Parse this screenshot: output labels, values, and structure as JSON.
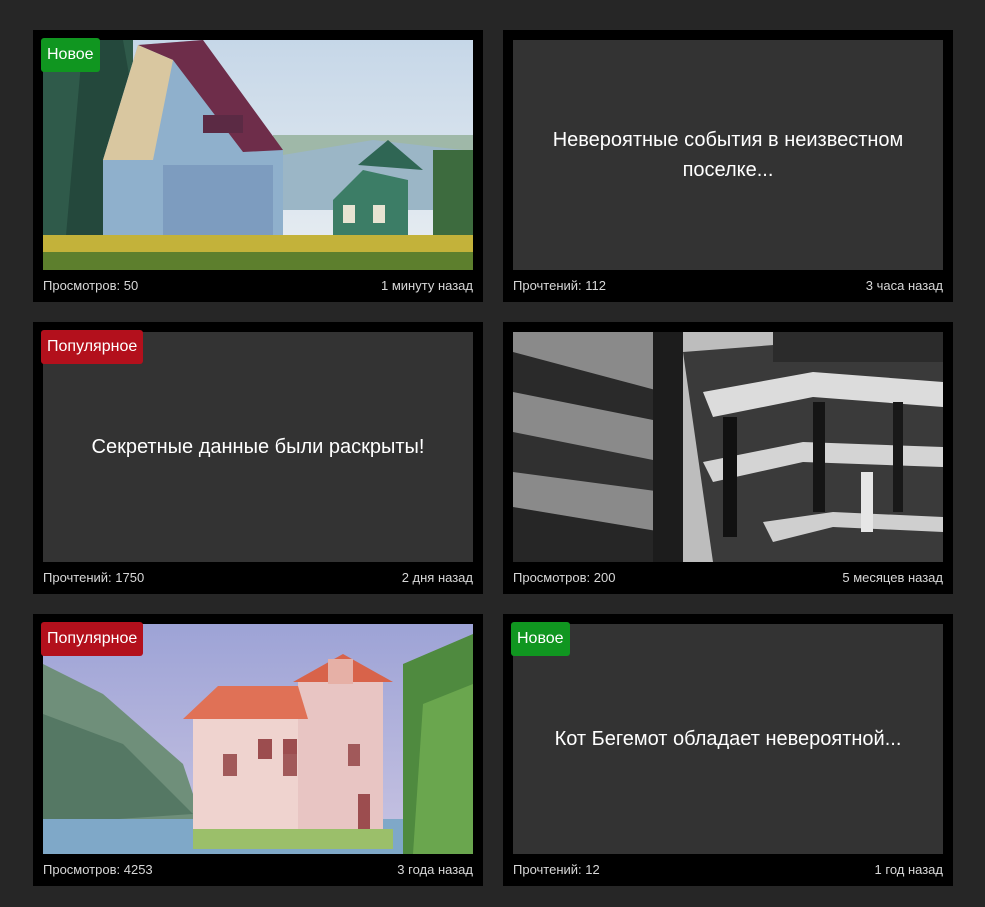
{
  "cards": [
    {
      "badge": "Новое",
      "badge_type": "new",
      "image": "painting-house-village",
      "title": "",
      "count_label": "Просмотров: 50",
      "time": "1 минуту назад"
    },
    {
      "badge": "",
      "badge_type": "",
      "image": "",
      "title": "Невероятные события в неизвестном поселке...",
      "count_label": "Прочтений: 112",
      "time": "3 часа назад"
    },
    {
      "badge": "Популярное",
      "badge_type": "popular",
      "image": "",
      "title": "Секретные данные были раскрыты!",
      "count_label": "Прочтений: 1750",
      "time": "2 дня назад"
    },
    {
      "badge": "",
      "badge_type": "",
      "image": "ink-building-construction",
      "title": "",
      "count_label": "Просмотров: 200",
      "time": "5 месяцев назад"
    },
    {
      "badge": "Популярное",
      "badge_type": "popular",
      "image": "painting-white-house-lake",
      "title": "",
      "count_label": "Просмотров: 4253",
      "time": "3 года назад"
    },
    {
      "badge": "Новое",
      "badge_type": "new",
      "image": "",
      "title": "Кот Бегемот обладает невероятной...",
      "count_label": "Прочтений: 12",
      "time": "1 год назад"
    }
  ],
  "colors": {
    "page_bg": "#262626",
    "card_bg": "#000000",
    "placeholder_bg": "#333333",
    "badge_new": "#109620",
    "badge_popular": "#b3101c",
    "meta_text": "#d8d8d8"
  }
}
